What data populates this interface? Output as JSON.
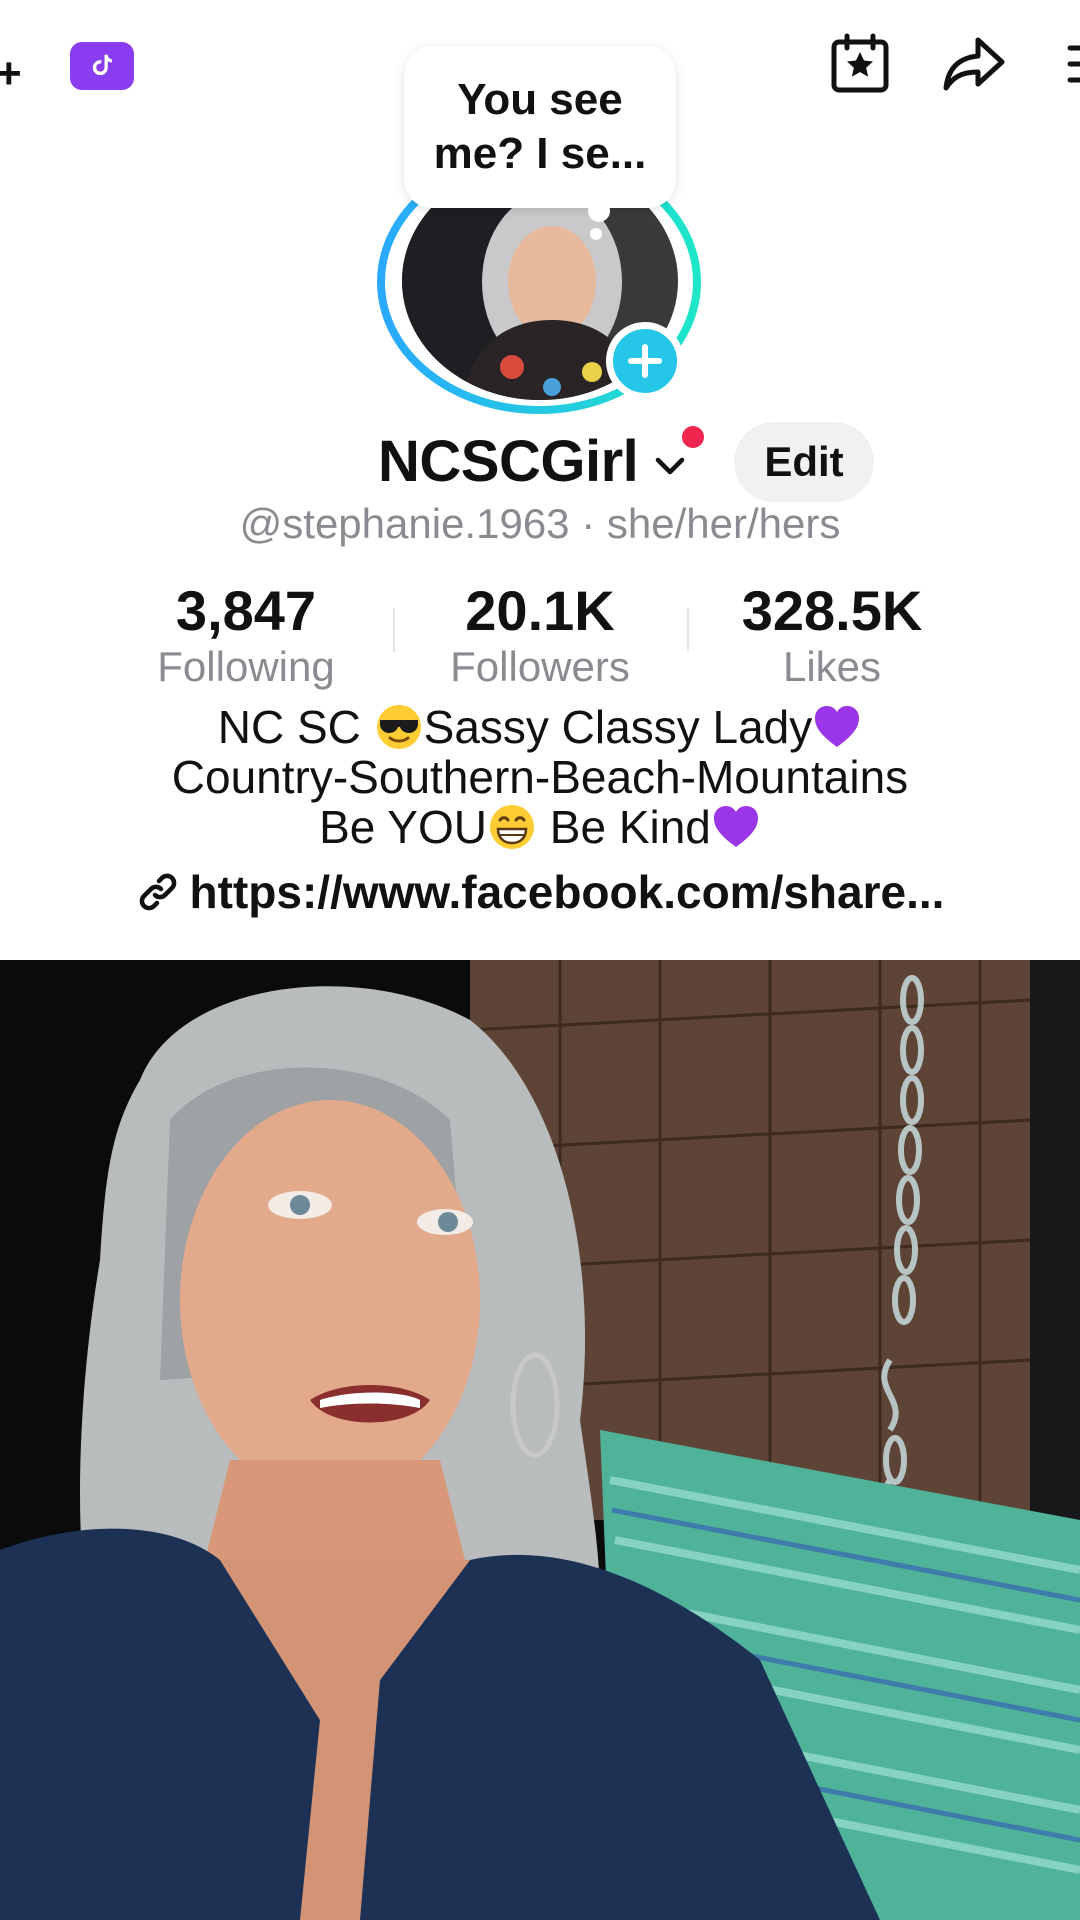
{
  "top_bar": {
    "add_icon": "plus-icon",
    "badge_icon": "tiktok-note-icon",
    "right_icons": [
      "calendar-star-icon",
      "share-arrow-icon",
      "menu-icon"
    ],
    "badge_color": "#8a3cf0"
  },
  "profile": {
    "status_note": "You see me? I se...",
    "display_name": "NCSCGirl",
    "edit_label": "Edit",
    "handle": "@stephanie.1963",
    "separator": "·",
    "pronouns": "she/her/hers",
    "ring_colors": [
      "#2aa9ff",
      "#1ee6c8"
    ],
    "notification_color": "#f0264e"
  },
  "stats": {
    "following": {
      "value": "3,847",
      "label": "Following"
    },
    "followers": {
      "value": "20.1K",
      "label": "Followers"
    },
    "likes": {
      "value": "328.5K",
      "label": "Likes"
    }
  },
  "bio": {
    "line1_a": "NC SC ",
    "line1_b": "Sassy Classy Lady",
    "line2": "Country-Southern-Beach-Mountains",
    "line3_a": "Be YOU",
    "line3_b": " Be Kind",
    "link": "https://www.facebook.com/share..."
  },
  "video": {
    "subject": "woman with long silver hair in navy top on porch swing"
  }
}
